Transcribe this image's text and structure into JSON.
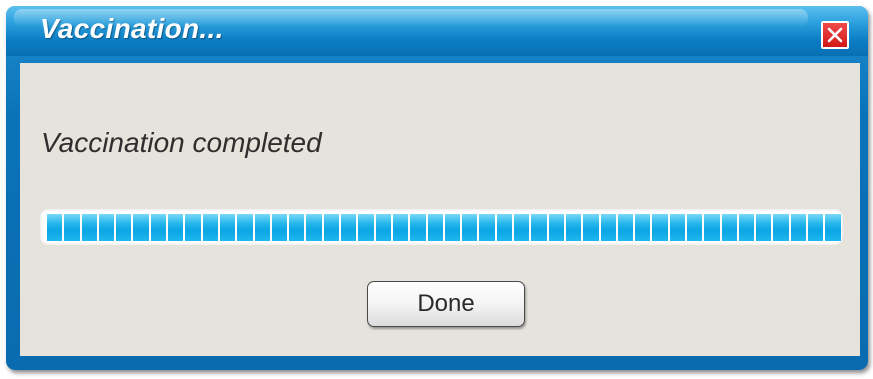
{
  "dialog": {
    "title": "Vaccination...",
    "close_icon": "close-icon",
    "message": "Vaccination completed",
    "progress": {
      "percent": 100,
      "segments": 46,
      "fill_color": "#0aa6e4"
    },
    "done_label": "Done"
  },
  "colors": {
    "titlebar": "#0b7cc3",
    "close_button": "#d11818",
    "content_bg": "#e6e2dc"
  }
}
